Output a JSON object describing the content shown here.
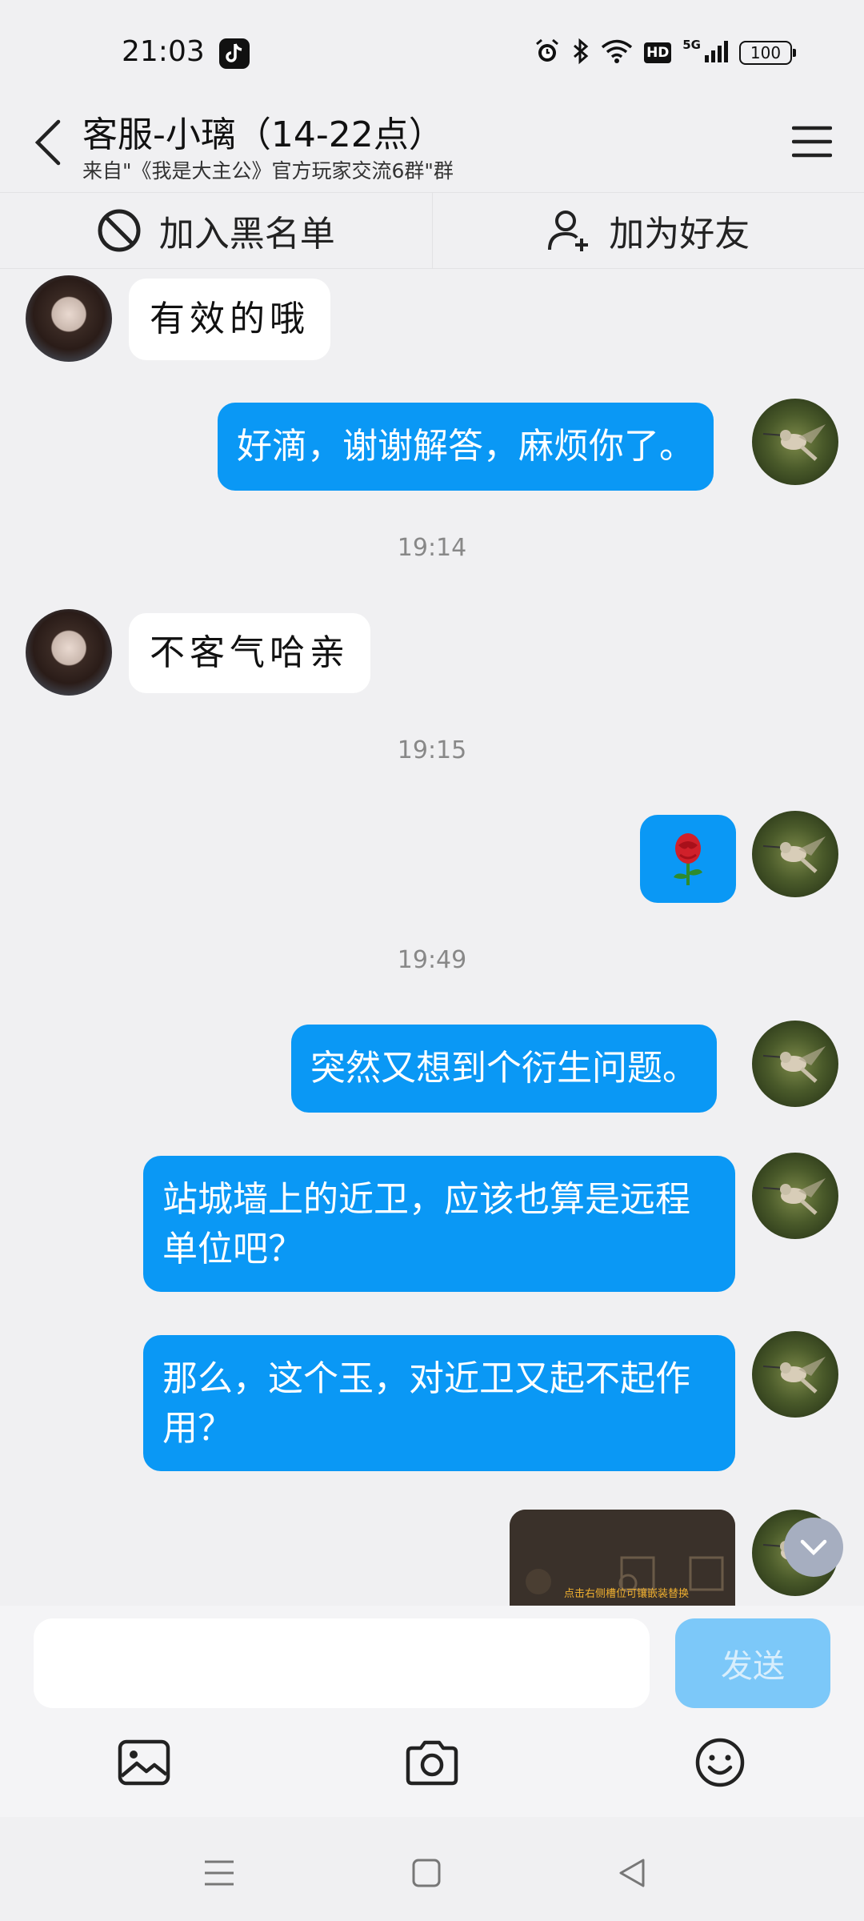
{
  "status_bar": {
    "time": "21:03",
    "network": "5G",
    "hd": "HD",
    "battery": "100",
    "icons": [
      "tiktok-icon",
      "alarm-icon",
      "bluetooth-icon",
      "wifi-icon",
      "signal-icon"
    ]
  },
  "header": {
    "title": "客服-小璃（14-22点）",
    "subtitle": "来自\"《我是大主公》官方玩家交流6群\"群"
  },
  "actions": {
    "blacklist_label": "加入黑名单",
    "add_friend_label": "加为好友"
  },
  "messages": [
    {
      "from": "them",
      "text": "有效的哦"
    },
    {
      "from": "me",
      "text": "好滴，谢谢解答，麻烦你了。"
    },
    {
      "type": "time",
      "text": "19:14"
    },
    {
      "from": "them",
      "text": "不客气哈亲"
    },
    {
      "type": "time",
      "text": "19:15"
    },
    {
      "from": "me",
      "type": "emoji",
      "icon": "rose-icon"
    },
    {
      "type": "time",
      "text": "19:49"
    },
    {
      "from": "me",
      "text": "突然又想到个衍生问题。"
    },
    {
      "from": "me",
      "text": "站城墙上的近卫，应该也算是远程单位吧？"
    },
    {
      "from": "me",
      "text": "那么，这个玉，对近卫又起不起作用？"
    },
    {
      "from": "me",
      "type": "image",
      "caption": "点击右侧槽位可镶嵌装替换"
    }
  ],
  "input": {
    "value": "",
    "send_label": "发送"
  },
  "colors": {
    "outgoing_bubble": "#0a98f5",
    "incoming_bubble": "#ffffff",
    "send_button_disabled": "#7cc8f9"
  }
}
